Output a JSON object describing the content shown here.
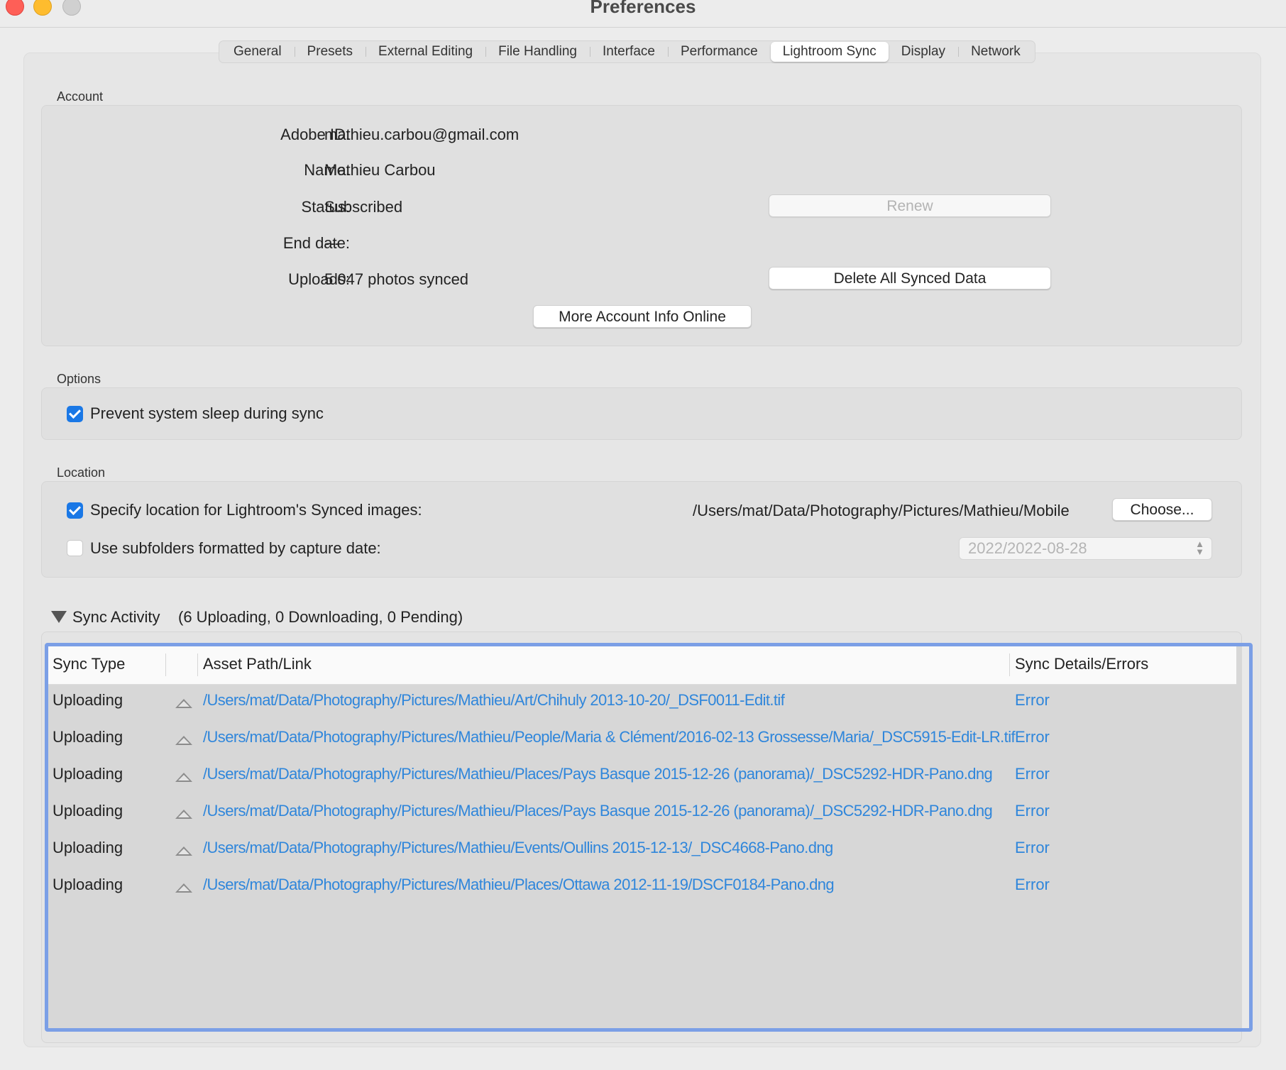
{
  "window": {
    "title": "Preferences"
  },
  "tabs": [
    "General",
    "Presets",
    "External Editing",
    "File Handling",
    "Interface",
    "Performance",
    "Lightroom Sync",
    "Display",
    "Network"
  ],
  "active_tab": "Lightroom Sync",
  "account": {
    "section_label": "Account",
    "adobe_id_label": "Adobe ID:",
    "adobe_id": "mathieu.carbou@gmail.com",
    "name_label": "Name:",
    "name": "Mathieu Carbou",
    "status_label": "Status:",
    "status": "Subscribed",
    "end_date_label": "End date:",
    "end_date": "---",
    "uploads_label": "Uploads:",
    "uploads": "5 047 photos synced",
    "renew_button": "Renew",
    "delete_button": "Delete All Synced Data",
    "more_info_button": "More Account Info Online"
  },
  "options": {
    "section_label": "Options",
    "prevent_sleep_label": "Prevent system sleep during sync",
    "prevent_sleep_checked": true
  },
  "location": {
    "section_label": "Location",
    "specify_label": "Specify location for Lightroom's Synced images:",
    "specify_checked": true,
    "path": "/Users/mat/Data/Photography/Pictures/Mathieu/Mobile",
    "choose_button": "Choose...",
    "subfolders_label": "Use subfolders formatted by capture date:",
    "subfolders_checked": false,
    "date_format": "2022/2022-08-28"
  },
  "sync_activity": {
    "title": "Sync Activity",
    "summary": "(6 Uploading, 0 Downloading, 0 Pending)",
    "columns": [
      "Sync Type",
      "Asset Path/Link",
      "Sync Details/Errors"
    ],
    "rows": [
      {
        "type": "Uploading",
        "path": "/Users/mat/Data/Photography/Pictures/Mathieu/Art/Chihuly 2013-10-20/_DSF0011-Edit.tif",
        "details": "Error"
      },
      {
        "type": "Uploading",
        "path": "/Users/mat/Data/Photography/Pictures/Mathieu/People/Maria & Clément/2016-02-13 Grossesse/Maria/_DSC5915-Edit-LR.tif",
        "details": "Error"
      },
      {
        "type": "Uploading",
        "path": "/Users/mat/Data/Photography/Pictures/Mathieu/Places/Pays Basque 2015-12-26 (panorama)/_DSC5292-HDR-Pano.dng",
        "details": "Error"
      },
      {
        "type": "Uploading",
        "path": "/Users/mat/Data/Photography/Pictures/Mathieu/Places/Pays Basque 2015-12-26 (panorama)/_DSC5292-HDR-Pano.dng",
        "details": "Error"
      },
      {
        "type": "Uploading",
        "path": "/Users/mat/Data/Photography/Pictures/Mathieu/Events/Oullins 2015-12-13/_DSC4668-Pano.dng",
        "details": "Error"
      },
      {
        "type": "Uploading",
        "path": "/Users/mat/Data/Photography/Pictures/Mathieu/Places/Ottawa 2012-11-19/DSCF0184-Pano.dng",
        "details": "Error"
      }
    ]
  }
}
